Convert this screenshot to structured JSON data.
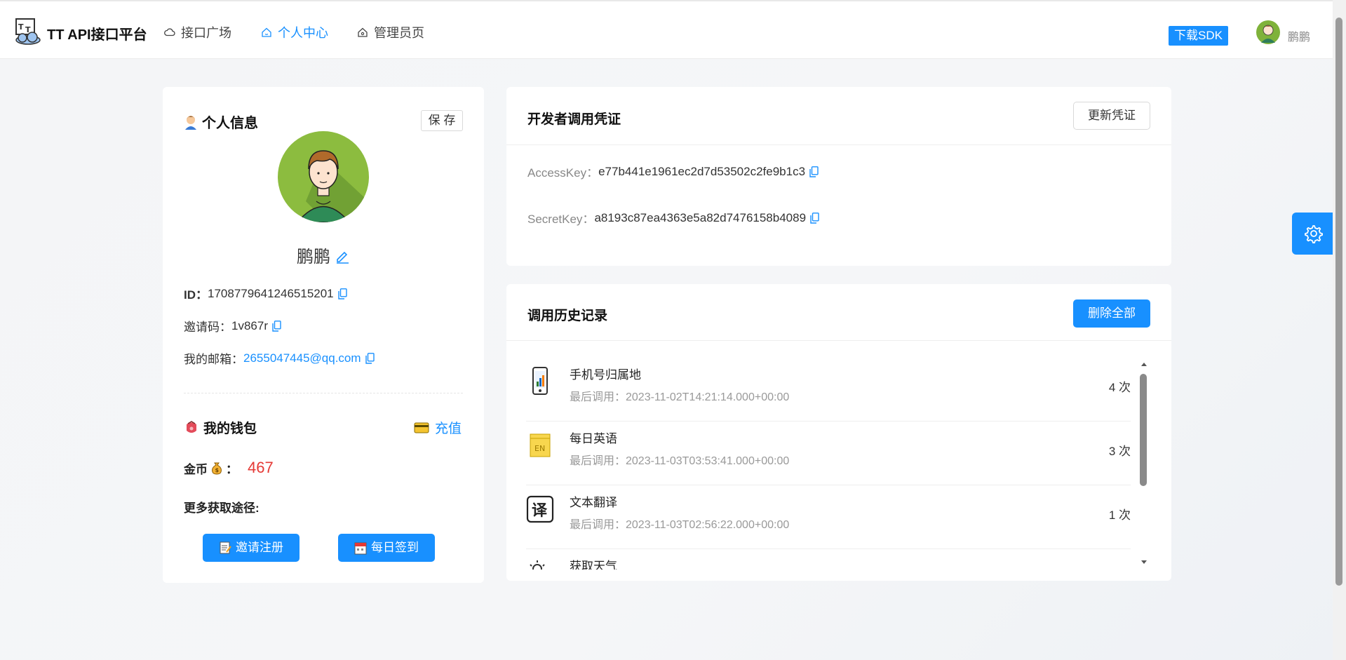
{
  "nav": {
    "brand": "TT API接口平台",
    "items": [
      {
        "label": "接口广场",
        "icon": "cloud-icon"
      },
      {
        "label": "个人中心",
        "icon": "home-icon",
        "active": true
      },
      {
        "label": "管理员页",
        "icon": "crown-icon"
      }
    ],
    "sdk_button": "下载SDK",
    "username": "鹏鹏"
  },
  "profile": {
    "title": "个人信息",
    "save_button": "保 存",
    "name": "鹏鹏",
    "id_label": "ID：",
    "id_value": "1708779641246515201",
    "invite_label": "邀请码：",
    "invite_value": "1v867r",
    "email_label": "我的邮箱：",
    "email_value": "2655047445@qq.com"
  },
  "wallet": {
    "title": "我的钱包",
    "recharge": "充值",
    "coins_label": "金币",
    "coins_suffix": "：",
    "coins_value": "467",
    "more_ways": "更多获取途径:",
    "invite_button": "邀请注册",
    "checkin_button": "每日签到"
  },
  "credentials": {
    "title": "开发者调用凭证",
    "refresh_button": "更新凭证",
    "access_key_label": "AccessKey：",
    "access_key_value": "e77b441e1961ec2d7d53502c2fe9b1c3",
    "secret_key_label": "SecretKey：",
    "secret_key_value": "a8193c87ea4363e5a82d7476158b4089"
  },
  "history": {
    "title": "调用历史记录",
    "delete_all_button": "删除全部",
    "items": [
      {
        "name": "手机号归属地",
        "time": "最后调用：2023-11-02T14:21:14.000+00:00",
        "count": "4 次",
        "icon": "phone-icon"
      },
      {
        "name": "每日英语",
        "time": "最后调用：2023-11-03T03:53:41.000+00:00",
        "count": "3 次",
        "icon": "english-note-icon"
      },
      {
        "name": "文本翻译",
        "time": "最后调用：2023-11-03T02:56:22.000+00:00",
        "count": "1 次",
        "icon": "translate-icon"
      },
      {
        "name": "获取天气",
        "time": "",
        "count": "",
        "icon": "weather-icon"
      }
    ]
  },
  "colors": {
    "primary": "#1890ff",
    "coins": "#e53935"
  }
}
